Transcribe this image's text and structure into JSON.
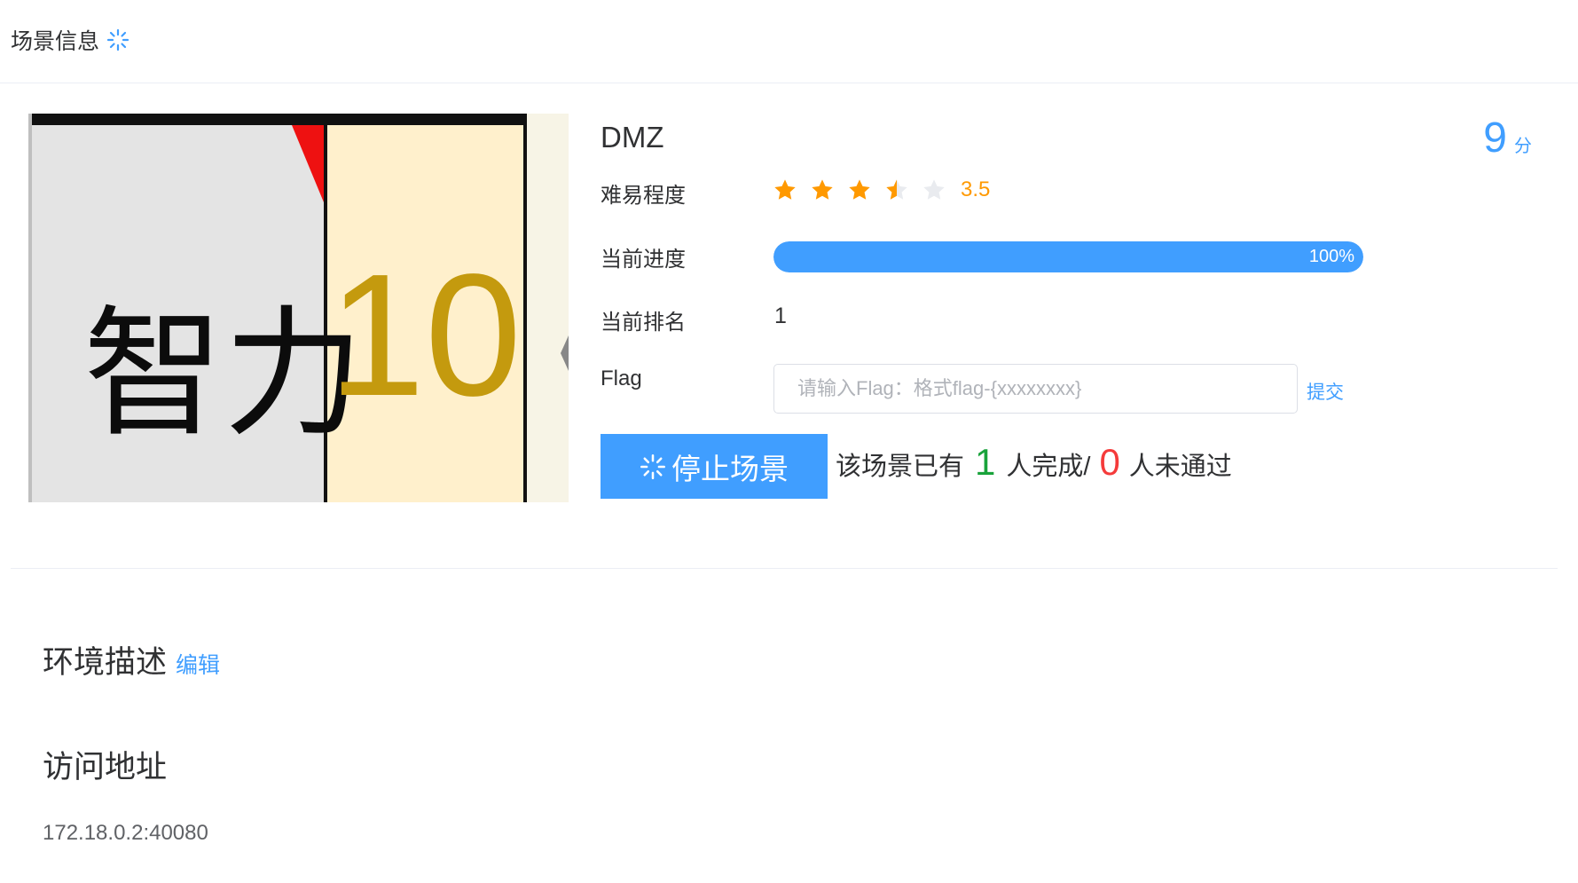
{
  "header": {
    "title": "场景信息",
    "icon": "loading-icon"
  },
  "scene": {
    "name": "DMZ",
    "score": "9",
    "score_unit": "分",
    "image": {
      "text_left": "智力",
      "text_right": "10"
    },
    "difficulty": {
      "label": "难易程度",
      "rating": 3.5,
      "rating_text": "3.5",
      "max": 5,
      "star_color": "#ff9900"
    },
    "progress": {
      "label": "当前进度",
      "percent": 100,
      "text": "100%",
      "color": "#409eff"
    },
    "rank": {
      "label": "当前排名",
      "value": "1"
    },
    "flag": {
      "label": "Flag",
      "placeholder": "请输入Flag：格式flag-{xxxxxxxx}",
      "value": "",
      "submit_label": "提交"
    },
    "stop_button": {
      "label": "停止场景",
      "icon": "loading-icon"
    },
    "completion": {
      "prefix": "该场景已有",
      "done_count": "1",
      "done_suffix": "人完成/",
      "fail_count": "0",
      "fail_suffix": "人未通过"
    }
  },
  "sections": {
    "environment": {
      "title": "环境描述",
      "edit_label": "编辑"
    },
    "access": {
      "title": "访问地址",
      "address": "172.18.0.2:40080"
    }
  },
  "colors": {
    "primary": "#409eff",
    "success": "#19a33b",
    "danger": "#f53b3b",
    "warning": "#ff9900"
  }
}
